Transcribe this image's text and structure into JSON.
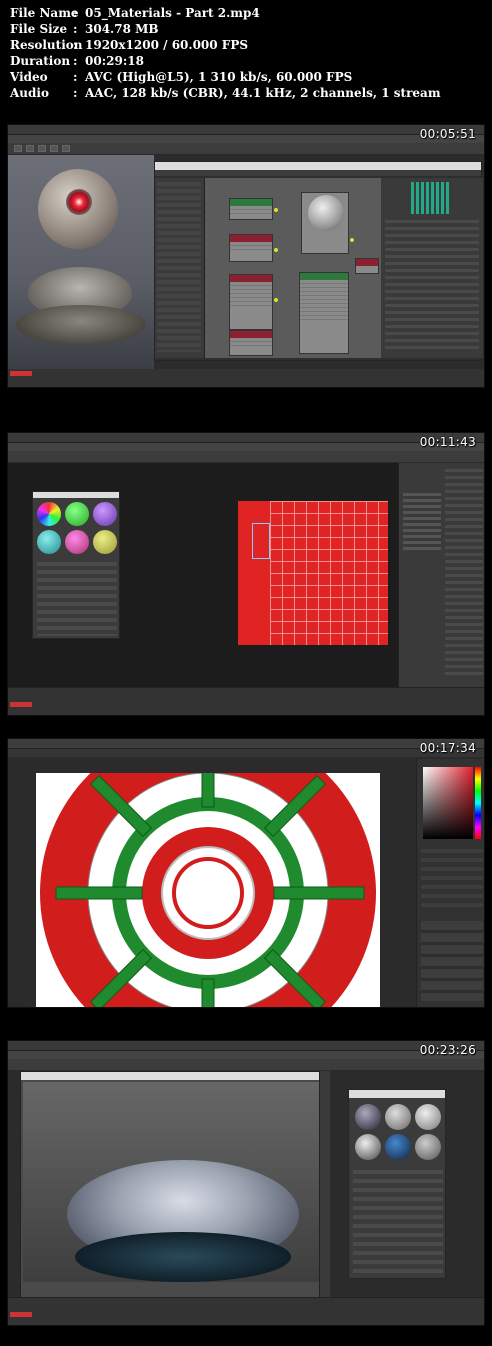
{
  "info": {
    "rows": [
      {
        "key": "File Name",
        "value": "05_Materials - Part 2.mp4"
      },
      {
        "key": "File Size",
        "value": "304.78 MB"
      },
      {
        "key": "Resolution",
        "value": "1920x1200 / 60.000 FPS"
      },
      {
        "key": "Duration",
        "value": "00:29:18"
      },
      {
        "key": "Video",
        "value": "AVC (High@L5), 1 310 kb/s, 60.000 FPS"
      },
      {
        "key": "Audio",
        "value": "AAC, 128 kb/s (CBR), 44.1 kHz, 2 channels, 1 stream"
      }
    ],
    "colon": ":"
  },
  "thumbnails": [
    {
      "timestamp": "00:05:51"
    },
    {
      "timestamp": "00:11:43"
    },
    {
      "timestamp": "00:17:34"
    },
    {
      "timestamp": "00:23:26"
    }
  ],
  "colors": {
    "max_bg": "#2b2b2b",
    "node_green": "#2d7a3c",
    "uv_red": "#e02323",
    "ring_green": "#1f8a2e",
    "ring_red": "#d21d1d"
  }
}
